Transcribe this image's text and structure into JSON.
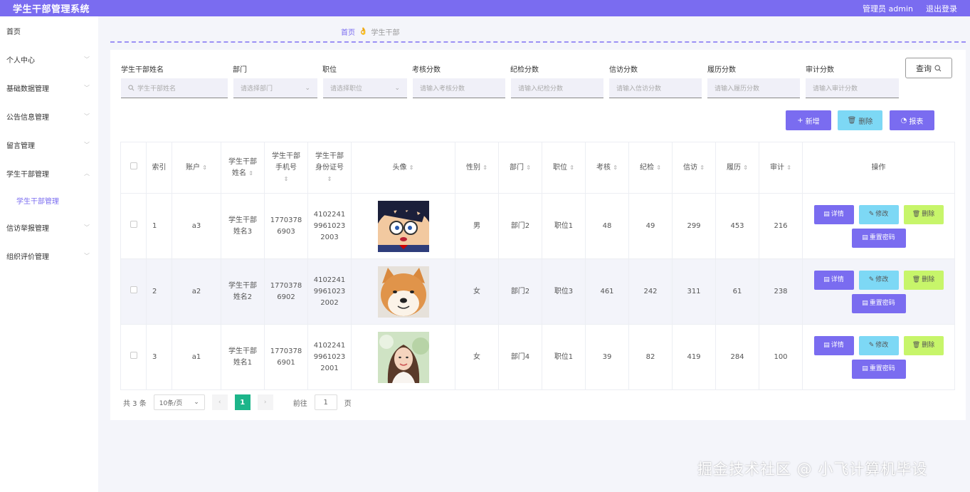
{
  "header": {
    "title": "学生干部管理系统",
    "admin_label": "管理员 admin",
    "logout_label": "退出登录"
  },
  "sidebar": {
    "items": [
      {
        "label": "首页",
        "chevron": ""
      },
      {
        "label": "个人中心",
        "chevron": "﹀"
      },
      {
        "label": "基础数据管理",
        "chevron": "﹀"
      },
      {
        "label": "公告信息管理",
        "chevron": "﹀"
      },
      {
        "label": "留言管理",
        "chevron": "﹀"
      },
      {
        "label": "学生干部管理",
        "chevron": "︿"
      },
      {
        "label": "信访举报管理",
        "chevron": "﹀"
      },
      {
        "label": "组织评价管理",
        "chevron": "﹀"
      }
    ],
    "sub_active": "学生干部管理"
  },
  "breadcrumb": {
    "home": "首页",
    "sep": "👌",
    "current": "学生干部"
  },
  "search": {
    "fields": [
      {
        "label": "学生干部姓名",
        "placeholder": "学生干部姓名",
        "icon": "search-icon"
      },
      {
        "label": "部门",
        "placeholder": "请选择部门",
        "icon": "chevron-down-icon"
      },
      {
        "label": "职位",
        "placeholder": "请选择职位",
        "icon": "chevron-down-icon"
      },
      {
        "label": "考核分数",
        "placeholder": "请输入考核分数"
      },
      {
        "label": "纪检分数",
        "placeholder": "请输入纪检分数"
      },
      {
        "label": "信访分数",
        "placeholder": "请输入信访分数"
      },
      {
        "label": "履历分数",
        "placeholder": "请输入履历分数"
      },
      {
        "label": "审计分数",
        "placeholder": "请输入审计分数"
      }
    ],
    "query_label": "查询"
  },
  "toolbar": {
    "add_label": "新增",
    "delete_label": "删除",
    "report_label": "报表"
  },
  "table": {
    "headers": {
      "index": "索引",
      "account": "账户",
      "name": "学生干部\n姓名",
      "phone": "学生干部\n手机号",
      "idcard": "学生干部\n身份证号",
      "avatar": "头像",
      "gender": "性别",
      "dept": "部门",
      "position": "职位",
      "assess": "考核",
      "discipline": "纪检",
      "petition": "信访",
      "resume": "履历",
      "audit": "审计",
      "ops": "操作"
    },
    "rows": [
      {
        "index": "1",
        "account": "a3",
        "name": "学生干部\n姓名3",
        "phone": "1770378\n6903",
        "idcard": "4102241\n9961023\n2003",
        "avatar": "cartoon-boy",
        "gender": "男",
        "dept": "部门2",
        "position": "职位1",
        "assess": "48",
        "discipline": "49",
        "petition": "299",
        "resume": "453",
        "audit": "216"
      },
      {
        "index": "2",
        "account": "a2",
        "name": "学生干部\n姓名2",
        "phone": "1770378\n6902",
        "idcard": "4102241\n9961023\n2002",
        "avatar": "shiba-dog",
        "gender": "女",
        "dept": "部门2",
        "position": "职位3",
        "assess": "461",
        "discipline": "242",
        "petition": "311",
        "resume": "61",
        "audit": "238"
      },
      {
        "index": "3",
        "account": "a1",
        "name": "学生干部\n姓名1",
        "phone": "1770378\n6901",
        "idcard": "4102241\n9961023\n2001",
        "avatar": "girl-photo",
        "gender": "女",
        "dept": "部门4",
        "position": "职位1",
        "assess": "39",
        "discipline": "82",
        "petition": "419",
        "resume": "284",
        "audit": "100"
      }
    ],
    "op_labels": {
      "detail": "详情",
      "edit": "修改",
      "delete": "删除",
      "reset": "重置密码"
    }
  },
  "pager": {
    "total": "共 3 条",
    "page_size": "10条/页",
    "current": "1",
    "goto_label": "前往",
    "goto_value": "1",
    "page_unit": "页"
  },
  "watermark": "掘金技术社区 @ 小飞计算机毕设",
  "colors": {
    "accent": "#7a6cf0",
    "cyan": "#7dd8f5",
    "lime": "#c7f56a",
    "pager_active": "#1db58a"
  }
}
